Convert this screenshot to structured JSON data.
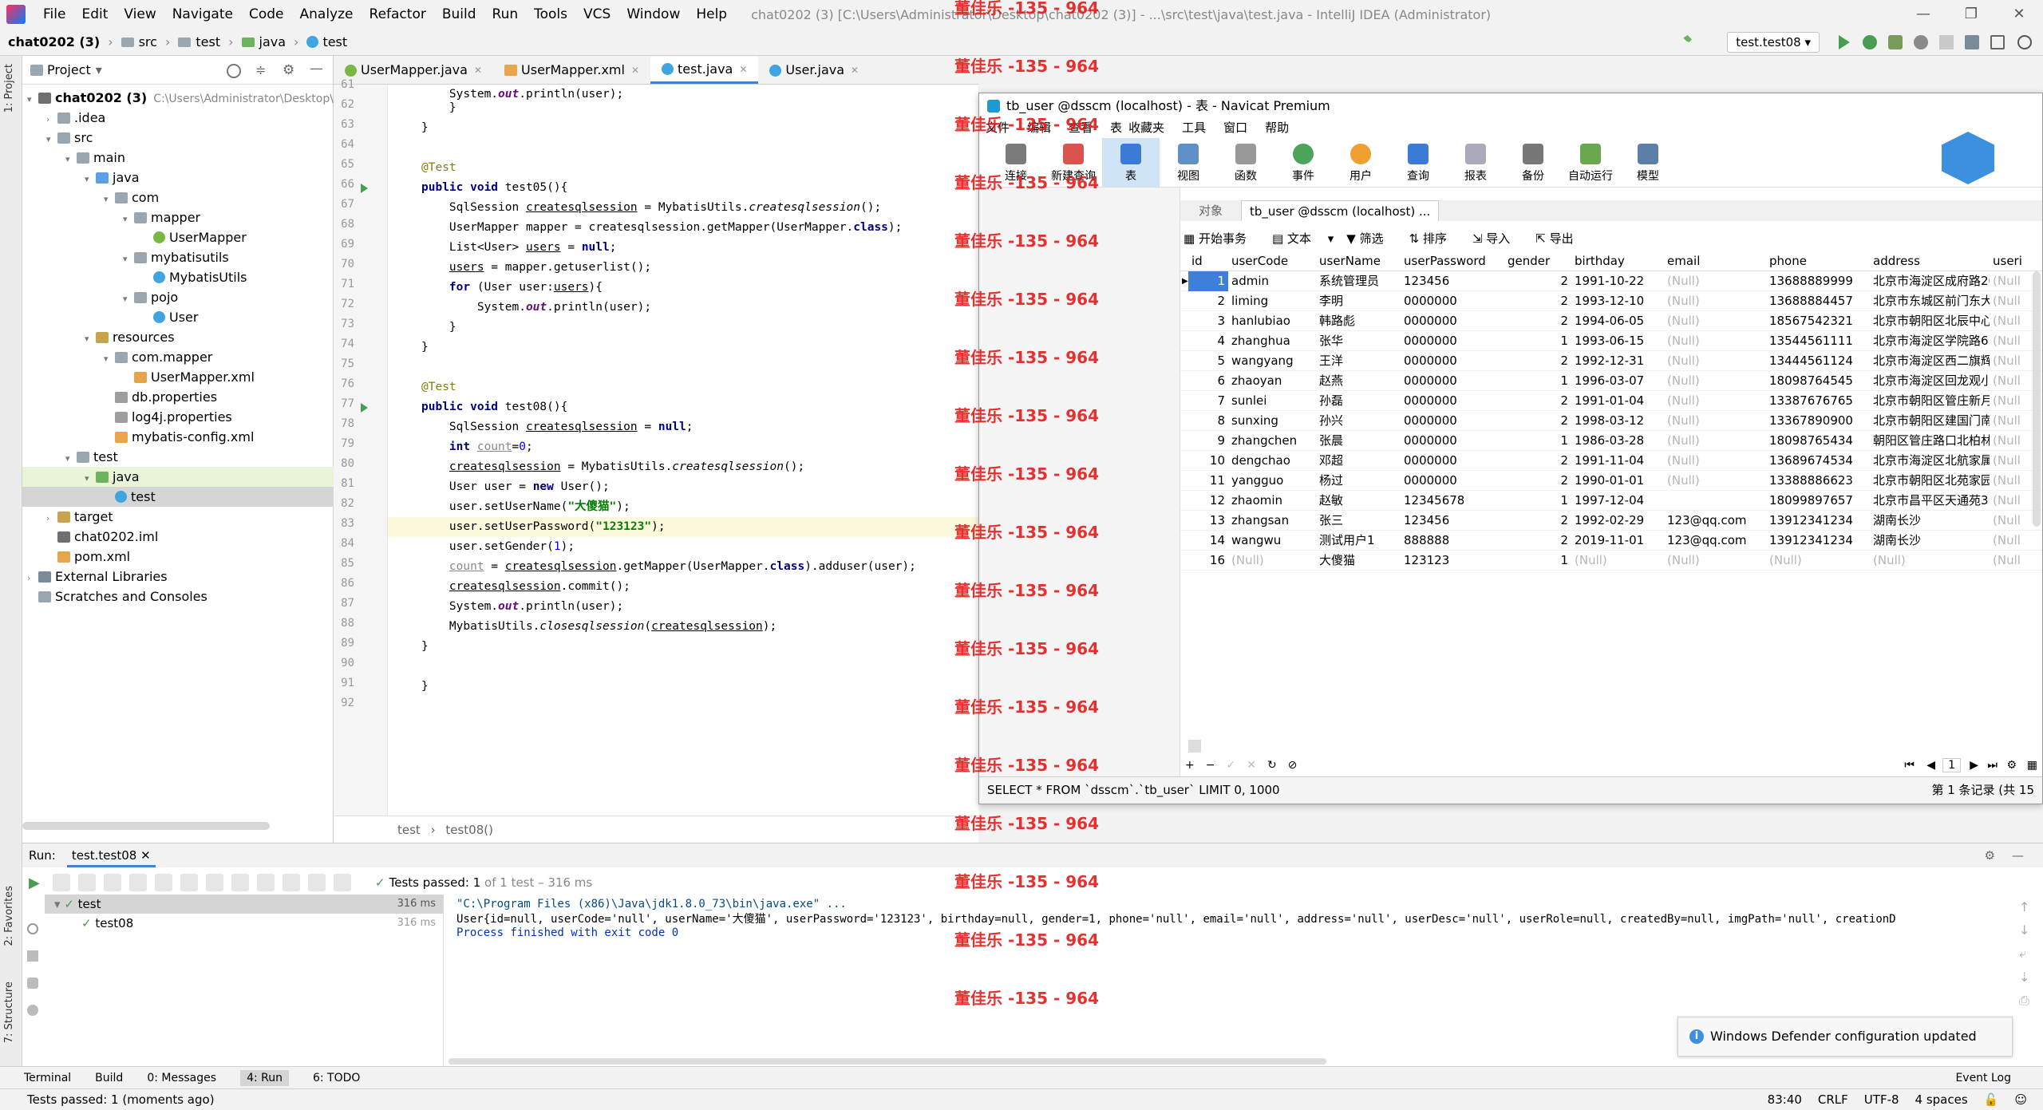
{
  "menubar": {
    "items": [
      "File",
      "Edit",
      "View",
      "Navigate",
      "Code",
      "Analyze",
      "Refactor",
      "Build",
      "Run",
      "Tools",
      "VCS",
      "Window",
      "Help"
    ],
    "title": "chat0202 (3) [C:\\Users\\Administrator\\Desktop\\chat0202 (3)] - ...\\src\\test\\java\\test.java - IntelliJ IDEA (Administrator)"
  },
  "navbar": {
    "crumbs": [
      "chat0202 (3)",
      "src",
      "test",
      "java",
      "test"
    ],
    "run_config": "test.test08"
  },
  "project": {
    "header": "Project",
    "tree": [
      {
        "label": "chat0202 (3)",
        "note": "C:\\Users\\Administrator\\Desktop\\"
      },
      {
        "label": ".idea"
      },
      {
        "label": "src"
      },
      {
        "label": "main"
      },
      {
        "label": "java"
      },
      {
        "label": "com"
      },
      {
        "label": "mapper"
      },
      {
        "label": "UserMapper"
      },
      {
        "label": "mybatisutils"
      },
      {
        "label": "MybatisUtils"
      },
      {
        "label": "pojo"
      },
      {
        "label": "User"
      },
      {
        "label": "resources"
      },
      {
        "label": "com.mapper"
      },
      {
        "label": "UserMapper.xml"
      },
      {
        "label": "db.properties"
      },
      {
        "label": "log4j.properties"
      },
      {
        "label": "mybatis-config.xml"
      },
      {
        "label": "test"
      },
      {
        "label": "java"
      },
      {
        "label": "test"
      },
      {
        "label": "target"
      },
      {
        "label": "chat0202.iml"
      },
      {
        "label": "pom.xml"
      },
      {
        "label": "External Libraries"
      },
      {
        "label": "Scratches and Consoles"
      }
    ]
  },
  "editor": {
    "tabs": [
      "UserMapper.java",
      "UserMapper.xml",
      "test.java",
      "User.java"
    ],
    "breadcrumb": [
      "test",
      "test08()"
    ],
    "line_numbers": [
      "61",
      "62",
      "63",
      "64",
      "65",
      "66",
      "67",
      "68",
      "69",
      "70",
      "71",
      "72",
      "73",
      "74",
      "75",
      "76",
      "77",
      "78",
      "79",
      "80",
      "81",
      "82",
      "83",
      "84",
      "85",
      "86",
      "87",
      "88",
      "89",
      "90",
      "91",
      "92"
    ]
  },
  "navicat": {
    "title": "tb_user @dsscm (localhost) - 表 - Navicat Premium",
    "menu": [
      "文件",
      "编辑",
      "查看",
      "表",
      "收藏夹",
      "工具",
      "窗口",
      "帮助"
    ],
    "tools": [
      "连接",
      "新建查询",
      "表",
      "视图",
      "函数",
      "事件",
      "用户",
      "查询",
      "报表",
      "备份",
      "自动运行",
      "模型"
    ],
    "obj_tabs": [
      "对象",
      "tb_user @dsscm (localhost) ..."
    ],
    "actions": [
      "开始事务",
      "文本",
      "筛选",
      "排序",
      "导入",
      "导出"
    ],
    "columns": [
      "id",
      "userCode",
      "userName",
      "userPassword",
      "gender",
      "birthday",
      "email",
      "phone",
      "address",
      "useri"
    ],
    "rows": [
      [
        "1",
        "admin",
        "系统管理员",
        "123456",
        "2",
        "1991-10-22",
        "(Null)",
        "13688889999",
        "北京市海淀区成府路20",
        "(Null"
      ],
      [
        "2",
        "liming",
        "李明",
        "0000000",
        "2",
        "1993-12-10",
        "(Null)",
        "13688884457",
        "北京市东城区前门东大",
        "(Null"
      ],
      [
        "3",
        "hanlubiao",
        "韩路彪",
        "0000000",
        "2",
        "1994-06-05",
        "(Null)",
        "18567542321",
        "北京市朝阳区北辰中心",
        "(Null"
      ],
      [
        "4",
        "zhanghua",
        "张华",
        "0000000",
        "1",
        "1993-06-15",
        "(Null)",
        "13544561111",
        "北京市海淀区学院路61",
        "(Null"
      ],
      [
        "5",
        "wangyang",
        "王洋",
        "0000000",
        "2",
        "1992-12-31",
        "(Null)",
        "13444561124",
        "北京市海淀区西二旗辉",
        "(Null"
      ],
      [
        "6",
        "zhaoyan",
        "赵燕",
        "0000000",
        "1",
        "1996-03-07",
        "(Null)",
        "18098764545",
        "北京市海淀区回龙观小",
        "(Null"
      ],
      [
        "7",
        "sunlei",
        "孙磊",
        "0000000",
        "2",
        "1991-01-04",
        "(Null)",
        "13387676765",
        "北京市朝阳区管庄新月",
        "(Null"
      ],
      [
        "8",
        "sunxing",
        "孙兴",
        "0000000",
        "2",
        "1998-03-12",
        "(Null)",
        "13367890900",
        "北京市朝阳区建国门南",
        "(Null"
      ],
      [
        "9",
        "zhangchen",
        "张晨",
        "0000000",
        "1",
        "1986-03-28",
        "(Null)",
        "18098765434",
        "朝阳区管庄路口北柏林",
        "(Null"
      ],
      [
        "10",
        "dengchao",
        "邓超",
        "0000000",
        "2",
        "1991-11-04",
        "(Null)",
        "13689674534",
        "北京市海淀区北航家属",
        "(Null"
      ],
      [
        "11",
        "yangguo",
        "杨过",
        "0000000",
        "2",
        "1990-01-01",
        "(Null)",
        "13388886623",
        "北京市朝阳区北苑家园",
        "(Null"
      ],
      [
        "12",
        "zhaomin",
        "赵敏",
        "12345678",
        "1",
        "1997-12-04",
        "",
        "18099897657",
        "北京市昌平区天通苑3区",
        "(Null"
      ],
      [
        "13",
        "zhangsan",
        "张三",
        "123456",
        "2",
        "1992-02-29",
        "123@qq.com",
        "13912341234",
        "湖南长沙",
        "(Null"
      ],
      [
        "14",
        "wangwu",
        "测试用户1",
        "888888",
        "2",
        "2019-11-01",
        "123@qq.com",
        "13912341234",
        "湖南长沙",
        "(Null"
      ],
      [
        "16",
        "(Null)",
        "大傻猫",
        "123123",
        "1",
        "(Null)",
        "(Null)",
        "(Null)",
        "(Null)",
        "(Null"
      ]
    ],
    "page": "1",
    "sql": "SELECT * FROM `dsscm`.`tb_user` LIMIT 0, 1000",
    "record": "第 1 条记录 (共 15"
  },
  "run": {
    "label": "Run:",
    "tab": "test.test08",
    "passed_prefix": "Tests passed:",
    "passed_count": "1",
    "passed_suffix": "of 1 test – 316 ms",
    "tree": [
      {
        "name": "test",
        "time": "316 ms"
      },
      {
        "name": "test08",
        "time": "316 ms"
      }
    ],
    "console": [
      "\"C:\\Program Files (x86)\\Java\\jdk1.8.0_73\\bin\\java.exe\" ...",
      "User{id=null, userCode='null', userName='大傻猫', userPassword='123123', birthday=null, gender=1, phone='null', email='null', address='null', userDesc='null', userRole=null, createdBy=null, imgPath='null', creationD",
      "",
      "Process finished with exit code 0"
    ]
  },
  "notification": "Windows Defender configuration updated",
  "toolwindows": [
    "Terminal",
    "Build",
    "0: Messages",
    "4: Run",
    "6: TODO"
  ],
  "event_log": "Event Log",
  "status": {
    "message": "Tests passed: 1 (moments ago)",
    "position": "83:40",
    "line_sep": "CRLF",
    "encoding": "UTF-8",
    "indent": "4 spaces"
  },
  "watermark": "董佳乐 -135 - 964",
  "side_tabs": [
    "1: Project",
    "2: Favorites",
    "7: Structure"
  ]
}
